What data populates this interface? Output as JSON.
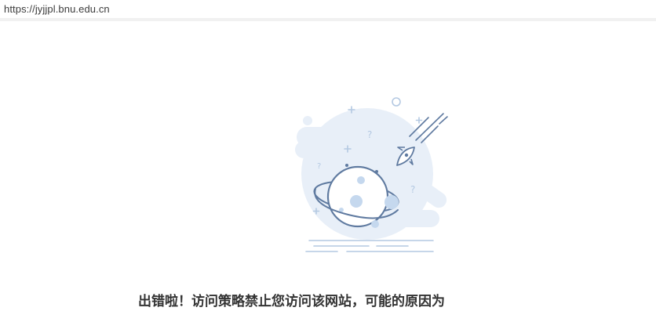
{
  "browser": {
    "url": "https://jyjjpl.bnu.edu.cn"
  },
  "illustration": {
    "icon": "planet-rocket-error-illustration",
    "colors": {
      "blob": "#e8eff8",
      "outline": "#5f7aa0",
      "fill": "#ffffff",
      "crater": "#c5d8ee",
      "lines": "#b4c9e2"
    }
  },
  "error": {
    "heading": "出错啦！访问策略禁止您访问该网站，可能的原因为"
  }
}
